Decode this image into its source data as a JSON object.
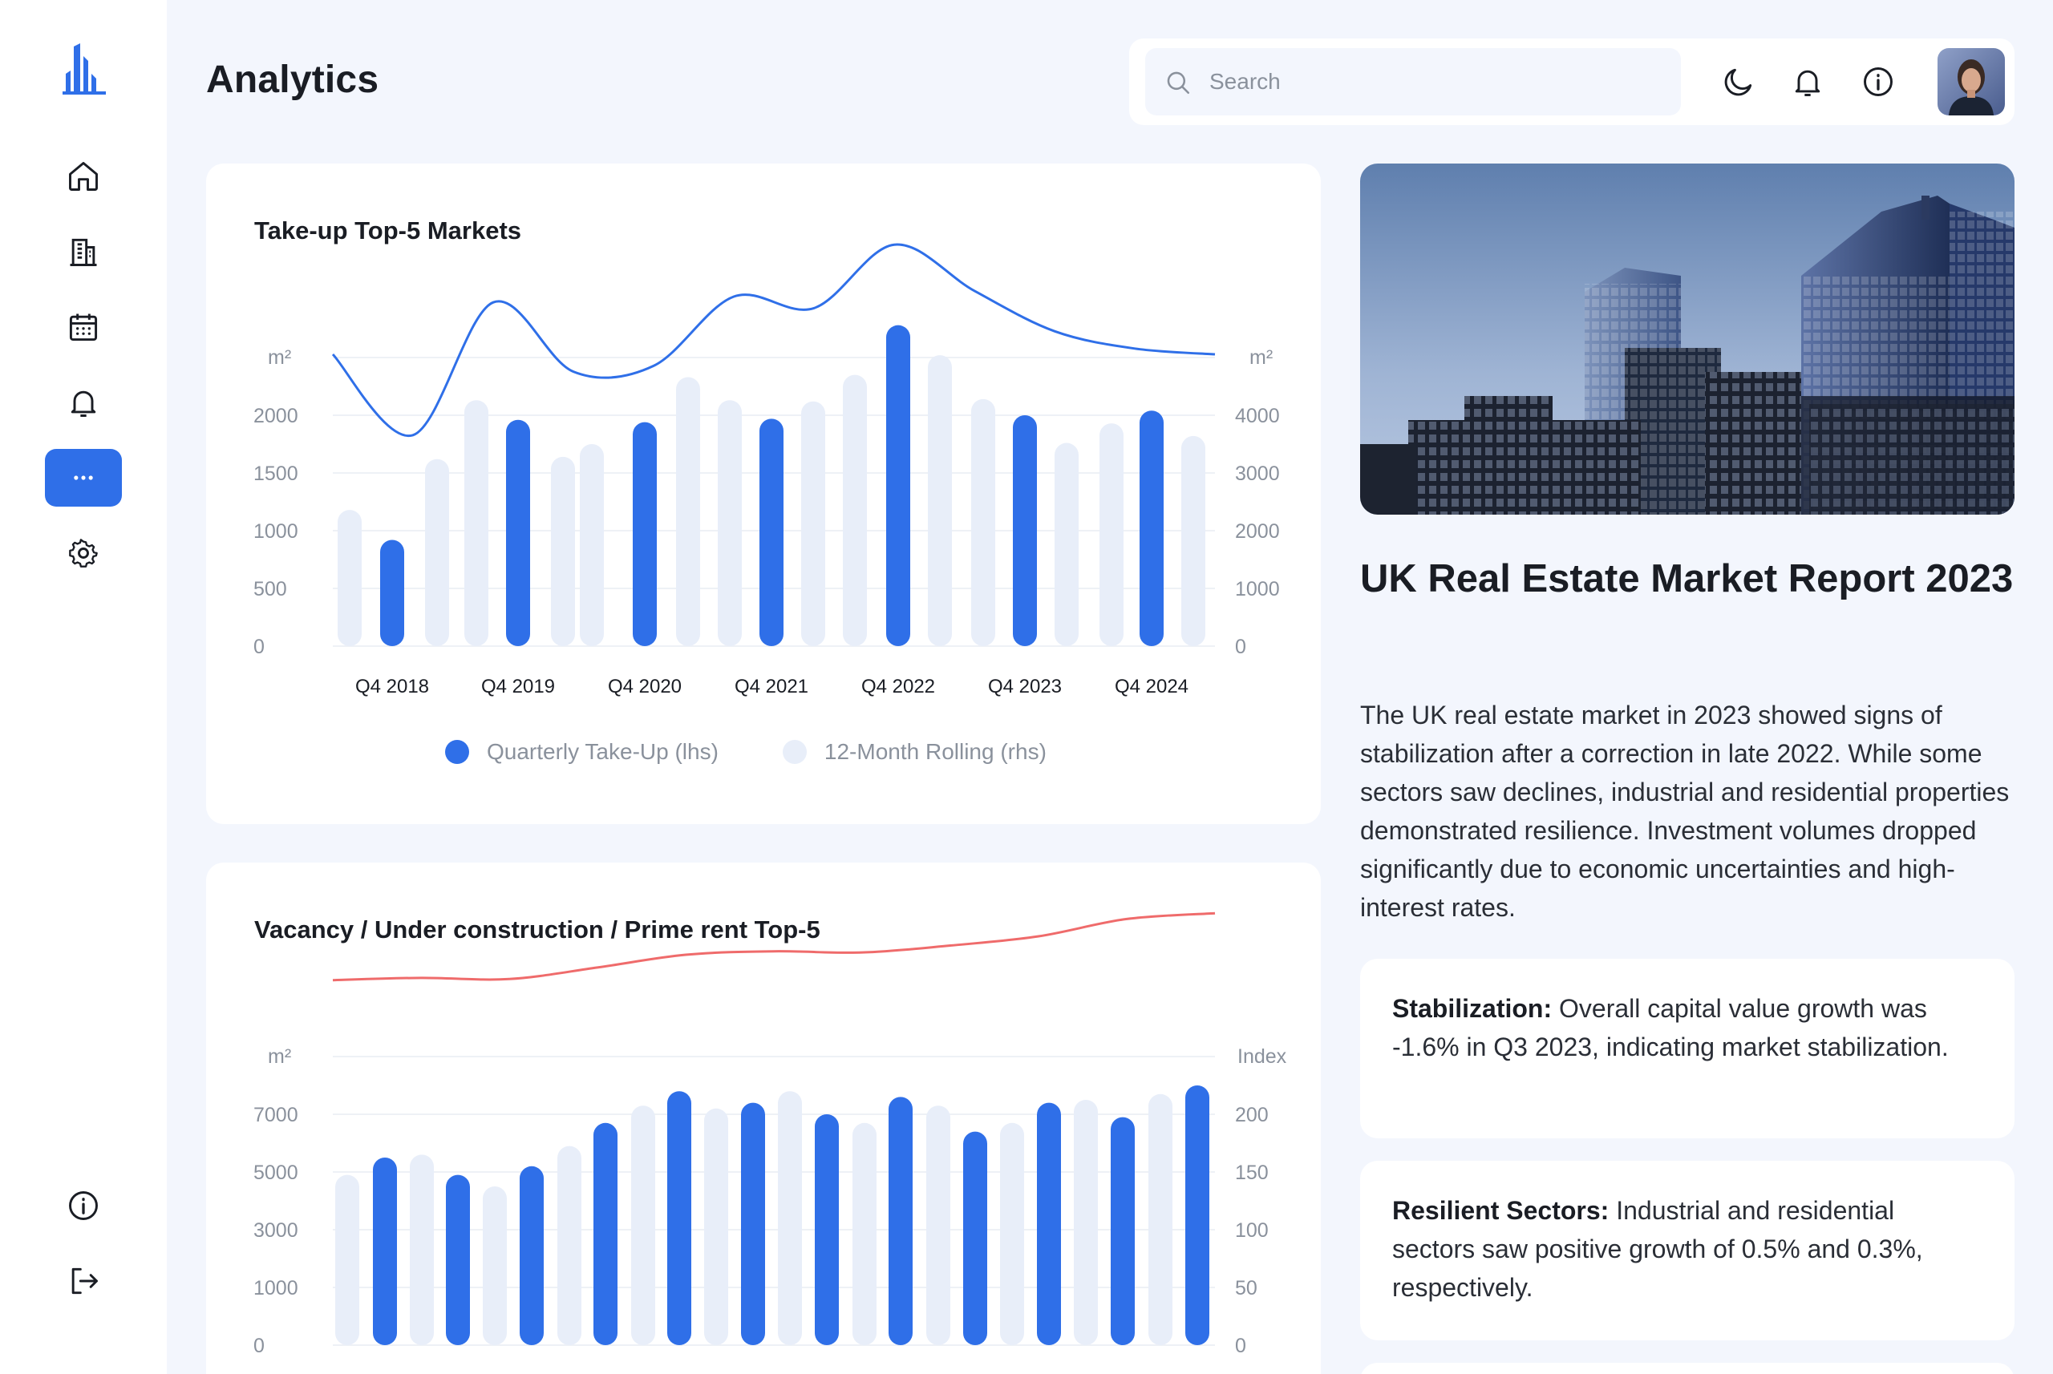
{
  "page": {
    "title": "Analytics"
  },
  "sidebar": {
    "logo": "building-logo-icon",
    "items": [
      {
        "name": "home",
        "icon": "home-icon"
      },
      {
        "name": "buildings",
        "icon": "building-icon"
      },
      {
        "name": "calendar",
        "icon": "calendar-icon"
      },
      {
        "name": "notifications",
        "icon": "bell-icon"
      },
      {
        "name": "more",
        "icon": "more-dots-icon",
        "active": true
      },
      {
        "name": "settings",
        "icon": "gear-icon"
      }
    ],
    "bottom_items": [
      {
        "name": "info",
        "icon": "info-icon"
      },
      {
        "name": "logout",
        "icon": "logout-icon"
      }
    ]
  },
  "topbar": {
    "search": {
      "placeholder": "Search",
      "value": ""
    },
    "icons": [
      "moon-icon",
      "bell-icon",
      "info-icon"
    ],
    "avatar": "user-avatar"
  },
  "colors": {
    "accent": "#2f6fe8",
    "light_bar": "#e8eef9",
    "rent_line": "#ef6b6b",
    "bg": "#f3f6fd"
  },
  "chart_data": [
    {
      "type": "bar",
      "title": "Take-up Top-5 Markets",
      "y_unit_left": "m²",
      "y_unit_right": "m²",
      "yticks_left": [
        "0",
        "500",
        "1000",
        "1500",
        "2000"
      ],
      "yticks_right": [
        "0",
        "1000",
        "2000",
        "3000",
        "4000"
      ],
      "ylim_left": [
        0,
        2500
      ],
      "ylim_right": [
        0,
        5000
      ],
      "x_tick_labels": [
        "Q4 2018",
        "Q4 2019",
        "Q4 2020",
        "Q4 2021",
        "Q4 2022",
        "Q4 2023",
        "Q4 2024"
      ],
      "legend_position": "bottom",
      "grid": true,
      "series": [
        {
          "name": "Quarterly Take-Up (lhs)",
          "kind": "bar",
          "color": "#2f6fe8",
          "values": [
            920,
            1960,
            1940,
            1970,
            2780,
            2000,
            2040
          ]
        },
        {
          "name": "12-Month Rolling (rhs)",
          "kind": "bar",
          "color": "#e8eef9",
          "values": [
            1180,
            1620,
            2130,
            1640,
            1750,
            2330,
            2130,
            2120,
            2350,
            2520,
            2140,
            1760,
            1930,
            1820
          ]
        },
        {
          "name": "",
          "kind": "line",
          "color": "#2f6fe8",
          "values": [
            4500,
            3100,
            5400,
            4200,
            4300,
            5500,
            5300,
            6400,
            5600,
            4900,
            4600,
            4500
          ]
        }
      ]
    },
    {
      "type": "bar",
      "title": "Vacancy / Under construction / Prime rent Top-5",
      "y_unit_left": "m²",
      "y_unit_right": "Index",
      "yticks_left": [
        "0",
        "1000",
        "3000",
        "5000",
        "7000"
      ],
      "yticks_right": [
        "0",
        "50",
        "100",
        "150",
        "200"
      ],
      "grid": true,
      "series": [
        {
          "name": "",
          "kind": "bar",
          "color": "#2f6fe8",
          "values": [
            6500,
            5900,
            6200,
            7700,
            8800,
            8400,
            8000,
            8600,
            7400,
            8400,
            7900,
            9000
          ]
        },
        {
          "name": "",
          "kind": "bar",
          "color": "#e8eef9",
          "values": [
            5900,
            6600,
            5500,
            6900,
            8300,
            8200,
            8800,
            7700,
            8300,
            7700,
            8500,
            8700
          ]
        },
        {
          "name": "",
          "kind": "line",
          "color": "#ef6b6b",
          "values": [
            212,
            214,
            213,
            223,
            234,
            237,
            236,
            242,
            250,
            265,
            270
          ]
        }
      ]
    }
  ],
  "report": {
    "title": "UK Real Estate Market Report 2023",
    "image": "city-skyscrapers-photo",
    "body": "The UK real estate market in 2023 showed signs of stabilization after a correction in late 2022. While some sectors saw declines, industrial and residential properties demonstrated resilience. Investment volumes dropped significantly due to economic uncertainties and high-interest rates.",
    "cards": [
      {
        "heading": "Stabilization:",
        "text": " Overall capital value growth was -1.6% in Q3 2023, indicating market stabilization."
      },
      {
        "heading": "Resilient Sectors:",
        "text": " Industrial and residential sectors saw positive growth of 0.5% and 0.3%, respectively."
      }
    ]
  }
}
